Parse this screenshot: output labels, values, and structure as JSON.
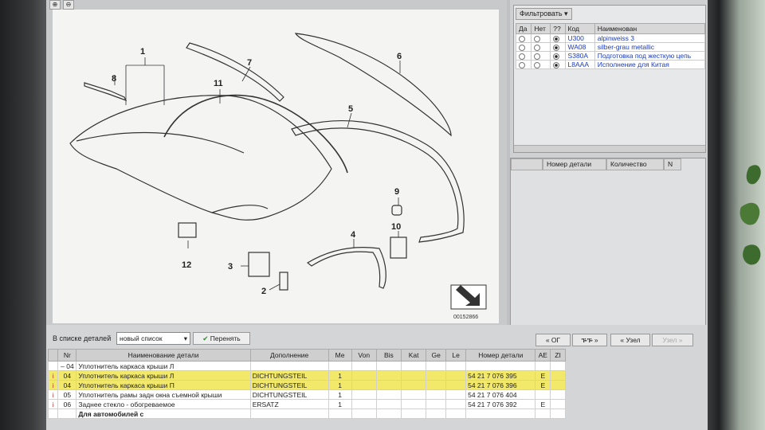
{
  "diagram": {
    "callouts": [
      "1",
      "2",
      "3",
      "4",
      "5",
      "6",
      "7",
      "8",
      "9",
      "10",
      "11",
      "12"
    ],
    "image_id": "00152866"
  },
  "filter": {
    "button_label": "Фильтровать",
    "columns": [
      "Да",
      "Нет",
      "??",
      "Код",
      "Наименован"
    ],
    "rows": [
      {
        "code": "U300",
        "name": "alpinweiss 3"
      },
      {
        "code": "WA08",
        "name": "silber-grau metallic"
      },
      {
        "code": "S380A",
        "name": "Подготовка под жесткую цепь"
      },
      {
        "code": "L8AAA",
        "name": "Исполнение для Китая"
      }
    ]
  },
  "parts_list": {
    "columns": [
      "Номер детали",
      "Количество",
      "N"
    ]
  },
  "toolbar": {
    "list_label": "В списке деталей",
    "list_select": "новый список",
    "apply_label": "Перенять",
    "nav": [
      "« ОГ",
      "ᎏᎏ »",
      "« Узел",
      "Узел »"
    ]
  },
  "details": {
    "columns": [
      "",
      "Nr",
      "Наименование детали",
      "Дополнение",
      "Me",
      "Von",
      "Bis",
      "Kat",
      "Ge",
      "Le",
      "Номер детали",
      "AE",
      "ZI"
    ],
    "rows": [
      {
        "icon": "",
        "mark": "–",
        "nr": "04",
        "name": "Уплотнитель каркаса крыши Л",
        "add": "",
        "me": "",
        "num": "",
        "ae": "",
        "hl": false
      },
      {
        "icon": "i",
        "mark": "",
        "nr": "04",
        "name": "Уплотнитель каркаса крыши Л",
        "add": "DICHTUNGSTEIL",
        "me": "1",
        "num": "54 21 7 076 395",
        "ae": "E",
        "hl": true
      },
      {
        "icon": "i",
        "mark": "",
        "nr": "04",
        "name": "Уплотнитель каркаса крыши П",
        "add": "DICHTUNGSTEIL",
        "me": "1",
        "num": "54 21 7 076 396",
        "ae": "E",
        "hl": true
      },
      {
        "icon": "i",
        "mark": "",
        "nr": "05",
        "name": "Уплотнитель рамы задн окна съемной крыши",
        "add": "DICHTUNGSTEIL",
        "me": "1",
        "num": "54 21 7 076 404",
        "ae": "",
        "hl": false
      },
      {
        "icon": "i",
        "mark": "",
        "nr": "06",
        "name": "Заднее стекло - обогреваемое",
        "add": "ERSATZ",
        "me": "1",
        "num": "54 21 7 076 392",
        "ae": "E",
        "hl": false
      },
      {
        "icon": "",
        "mark": "",
        "nr": "",
        "name": "Для автомобилей с",
        "add": "",
        "me": "",
        "num": "",
        "ae": "",
        "hl": false
      }
    ]
  },
  "colors": {
    "highlight": "#f2e96b",
    "link": "#1a3bc0"
  }
}
